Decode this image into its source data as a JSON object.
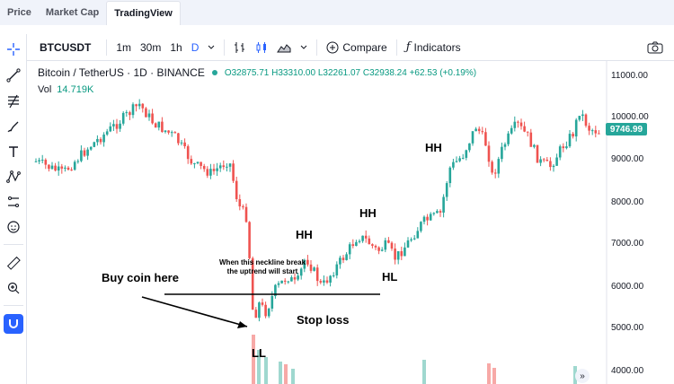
{
  "page_tabs": [
    {
      "label": "Price",
      "active": false
    },
    {
      "label": "Market Cap",
      "active": false
    },
    {
      "label": "TradingView",
      "active": true
    }
  ],
  "toolbar": {
    "symbol": "BTCUSDT",
    "intervals": [
      "1m",
      "30m",
      "1h",
      "D"
    ],
    "active_interval": "D",
    "compare_label": "Compare",
    "indicators_label": "Indicators"
  },
  "legend": {
    "title": "Bitcoin / TetherUS · 1D · BINANCE",
    "ohlc": "O32875.71 H33310.00 L32261.07 C32938.24 +62.53 (+0.19%)",
    "volume_label": "Vol",
    "volume_value": "14.719K"
  },
  "price_axis": {
    "ticks": [
      "11000.00",
      "10000.00",
      "9000.00",
      "8000.00",
      "7000.00",
      "6000.00",
      "5000.00",
      "4000.00"
    ],
    "current_price": "9746.99"
  },
  "annotations": {
    "hh_labels": [
      "HH",
      "HH",
      "HH"
    ],
    "hl_label": "HL",
    "ll_label": "LL",
    "buy_label": "Buy coin here",
    "stop_loss_label": "Stop loss",
    "neckline_note_line1": "When this neckline break",
    "neckline_note_line2": "the uptrend will start"
  },
  "colors": {
    "up": "#26a69a",
    "down": "#ef5350",
    "accent": "#2962ff"
  },
  "icons": [
    "crosshair-icon",
    "trendline-icon",
    "fib-icon",
    "brush-icon",
    "text-icon",
    "pattern-icon",
    "measure-icon",
    "emoji-icon",
    "ruler-icon",
    "zoom-icon",
    "magnet-icon",
    "camera-icon"
  ]
}
